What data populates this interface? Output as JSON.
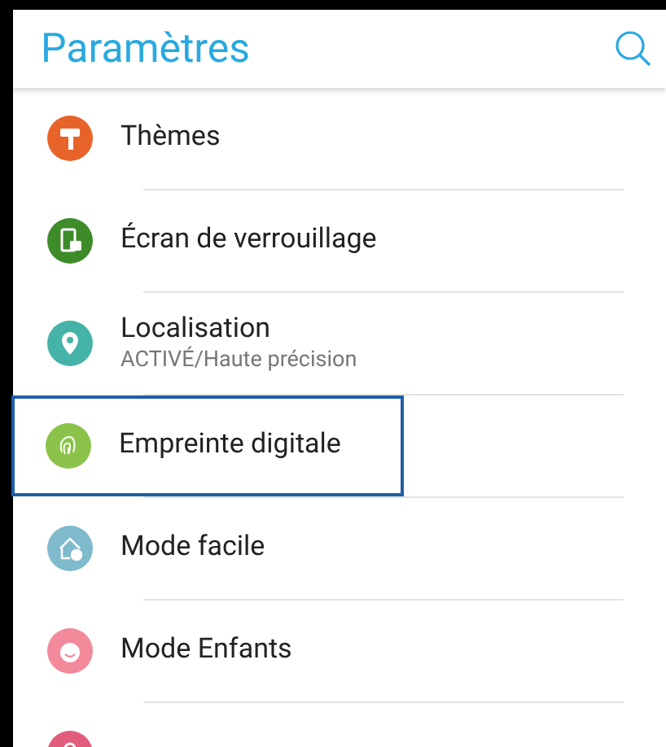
{
  "header": {
    "title": "Paramètres"
  },
  "items": [
    {
      "label": "Thèmes",
      "kind": "roller",
      "color": "#e8632a",
      "selected": false
    },
    {
      "label": "Écran de verrouillage",
      "kind": "lock",
      "color": "#3e8b2a",
      "selected": false
    },
    {
      "label": "Localisation",
      "subtitle": "ACTIVÉ/Haute précision",
      "kind": "pin",
      "color": "#45b3a8",
      "selected": false
    },
    {
      "label": "Empreinte digitale",
      "kind": "fingerprint",
      "color": "#8bc34a",
      "selected": true
    },
    {
      "label": "Mode facile",
      "kind": "house",
      "color": "#7fbacd",
      "selected": false
    },
    {
      "label": "Mode Enfants",
      "kind": "child",
      "color": "#f28a9b",
      "selected": false
    },
    {
      "kind": "padlock",
      "color": "#e25c7c",
      "selected": false
    }
  ]
}
